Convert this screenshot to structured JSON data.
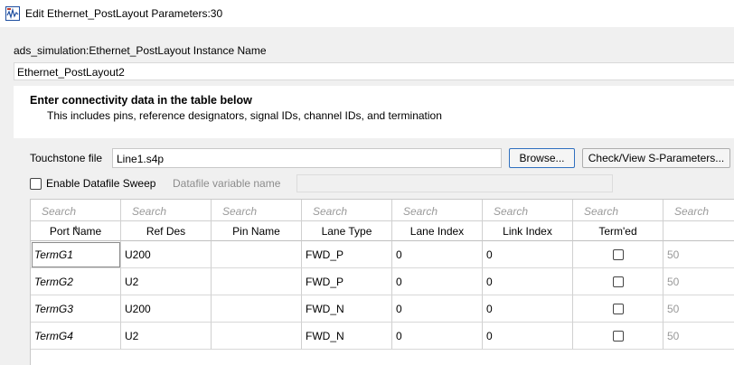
{
  "window": {
    "title": "Edit Ethernet_PostLayout Parameters:30",
    "icon": "ads-app-icon"
  },
  "instance": {
    "label": "ads_simulation:Ethernet_PostLayout Instance Name",
    "value": "Ethernet_PostLayout2"
  },
  "info": {
    "title": "Enter connectivity data in the table below",
    "subtitle": "This includes pins, reference designators, signal IDs, channel IDs, and termination"
  },
  "touchstone": {
    "label": "Touchstone file",
    "value": "Line1.s4p",
    "browse_label": "Browse...",
    "check_label": "Check/View S-Parameters..."
  },
  "sweep": {
    "checkbox_label": "Enable Datafile Sweep",
    "checked": false,
    "variable_label": "Datafile variable name",
    "variable_value": ""
  },
  "table": {
    "search_placeholder": "Search",
    "columns": [
      "Port Name",
      "Ref Des",
      "Pin Name",
      "Lane Type",
      "Lane Index",
      "Link Index",
      "Term'ed",
      ""
    ],
    "sorted_column": "Port Name",
    "rows": [
      {
        "port": "TermG1",
        "ref": "U200",
        "pin": "",
        "lane_type": "FWD_P",
        "lane_index": "0",
        "link_index": "0",
        "termed": false,
        "extra": "50"
      },
      {
        "port": "TermG2",
        "ref": "U2",
        "pin": "",
        "lane_type": "FWD_P",
        "lane_index": "0",
        "link_index": "0",
        "termed": false,
        "extra": "50"
      },
      {
        "port": "TermG3",
        "ref": "U200",
        "pin": "",
        "lane_type": "FWD_N",
        "lane_index": "0",
        "link_index": "0",
        "termed": false,
        "extra": "50"
      },
      {
        "port": "TermG4",
        "ref": "U2",
        "pin": "",
        "lane_type": "FWD_N",
        "lane_index": "0",
        "link_index": "0",
        "termed": false,
        "extra": "50"
      }
    ]
  }
}
